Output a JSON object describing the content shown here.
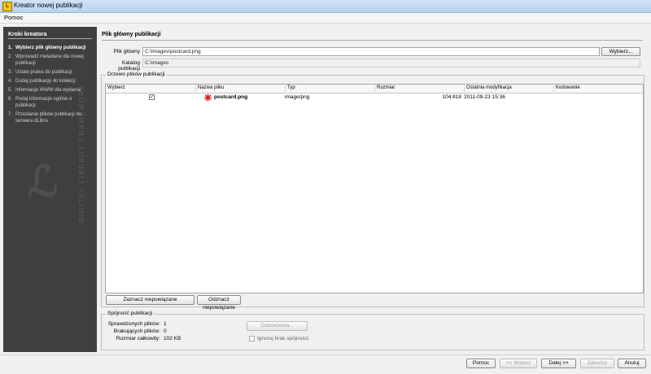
{
  "window": {
    "title": "Kreator nowej publikacji",
    "app_icon": "app-icon"
  },
  "menu": {
    "items": [
      "Pomoc"
    ]
  },
  "sidebar": {
    "title": "Kroki kreatora",
    "steps": [
      {
        "num": "1.",
        "label": "Wybierz plik główny publikacji"
      },
      {
        "num": "2.",
        "label": "Wprowadź metadane dla nowej publikacji"
      },
      {
        "num": "3.",
        "label": "Ustaw prawa do publikacji"
      },
      {
        "num": "4.",
        "label": "Dodaj publikację do kolekcji"
      },
      {
        "num": "5.",
        "label": "Informacje WWW dla wydania"
      },
      {
        "num": "6.",
        "label": "Podaj informacje ogólne o publikacji"
      },
      {
        "num": "7.",
        "label": "Przesłanie plików publikacji do serwera dLibra"
      }
    ],
    "watermark_text": "DIGITAL LIBRARY FRAMEWORK"
  },
  "main": {
    "section_title": "Plik główny publikacji",
    "main_file_label": "Plik główny",
    "main_file_value": "C:\\images\\postcard.png",
    "choose_button": "Wybierz...",
    "catalog_label": "Katalog publikacji",
    "catalog_value": "C:\\images"
  },
  "tree": {
    "title": "Drzewo plików publikacji",
    "columns": [
      "Wybierz",
      "Nazwa pliku",
      "Typ",
      "Rozmiar",
      "Ostatnia modyfikacja",
      "Kodowanie"
    ],
    "rows": [
      {
        "checked": "✓",
        "name": "postcard.png",
        "type": "image/png",
        "size": "104 818",
        "modified": "2011-09-23 15:36",
        "encoding": ""
      }
    ],
    "mark_button": "Zaznacz niepowiązane",
    "unmark_button": "Odznacz niepowiązane"
  },
  "consistency": {
    "title": "Spójność publikacji",
    "checked_label": "Sprawdzonych plików:",
    "checked_value": "1",
    "missing_label": "Brakujących plików:",
    "missing_value": "0",
    "total_label": "Rozmiar całkowity:",
    "total_value": "102 KB",
    "warnings_button": "Ostrzeżenia...",
    "ignore_label": "Ignoruj brak spójności"
  },
  "footer": {
    "help": "Pomoc",
    "back": "<< Wstecz",
    "next": "Dalej >>",
    "finish": "Zakończ",
    "cancel": "Anuluj"
  }
}
